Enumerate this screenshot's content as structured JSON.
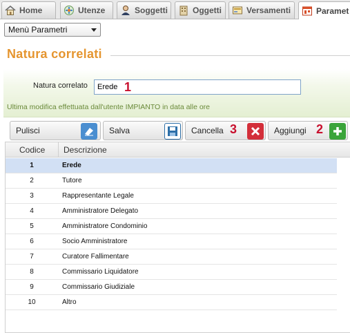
{
  "tabs": [
    {
      "label": "Home",
      "icon": "home-icon"
    },
    {
      "label": "Utenze",
      "icon": "users-icon"
    },
    {
      "label": "Soggetti",
      "icon": "person-icon"
    },
    {
      "label": "Oggetti",
      "icon": "building-icon"
    },
    {
      "label": "Versamenti",
      "icon": "payment-icon"
    },
    {
      "label": "Paramet",
      "icon": "params-icon"
    }
  ],
  "menu": {
    "selected": "Menù Parametri"
  },
  "page": {
    "title": "Natura correlati"
  },
  "form": {
    "field_label": "Natura correlato",
    "field_value": "Erede",
    "info": "Ultima modifica effettuata dall'utente IMPIANTO in data alle ore"
  },
  "badges": {
    "one": "1",
    "two": "2",
    "three": "3"
  },
  "buttons": {
    "pulisci": "Pulisci",
    "salva": "Salva",
    "cancella": "Cancella",
    "aggiungi": "Aggiungi"
  },
  "colors": {
    "title": "#e5952f",
    "badge": "#c8102e",
    "delete": "#d32f3a",
    "add": "#3aa43a",
    "save": "#2c6fa8"
  },
  "table": {
    "headers": {
      "codice": "Codice",
      "descrizione": "Descrizione"
    },
    "rows": [
      {
        "codice": "1",
        "descrizione": "Erede"
      },
      {
        "codice": "2",
        "descrizione": "Tutore"
      },
      {
        "codice": "3",
        "descrizione": "Rappresentante Legale"
      },
      {
        "codice": "4",
        "descrizione": "Amministratore Delegato"
      },
      {
        "codice": "5",
        "descrizione": "Amministratore Condominio"
      },
      {
        "codice": "6",
        "descrizione": "Socio Amministratore"
      },
      {
        "codice": "7",
        "descrizione": "Curatore Fallimentare"
      },
      {
        "codice": "8",
        "descrizione": "Commissario Liquidatore"
      },
      {
        "codice": "9",
        "descrizione": "Commissario Giudiziale"
      },
      {
        "codice": "10",
        "descrizione": "Altro"
      }
    ]
  }
}
